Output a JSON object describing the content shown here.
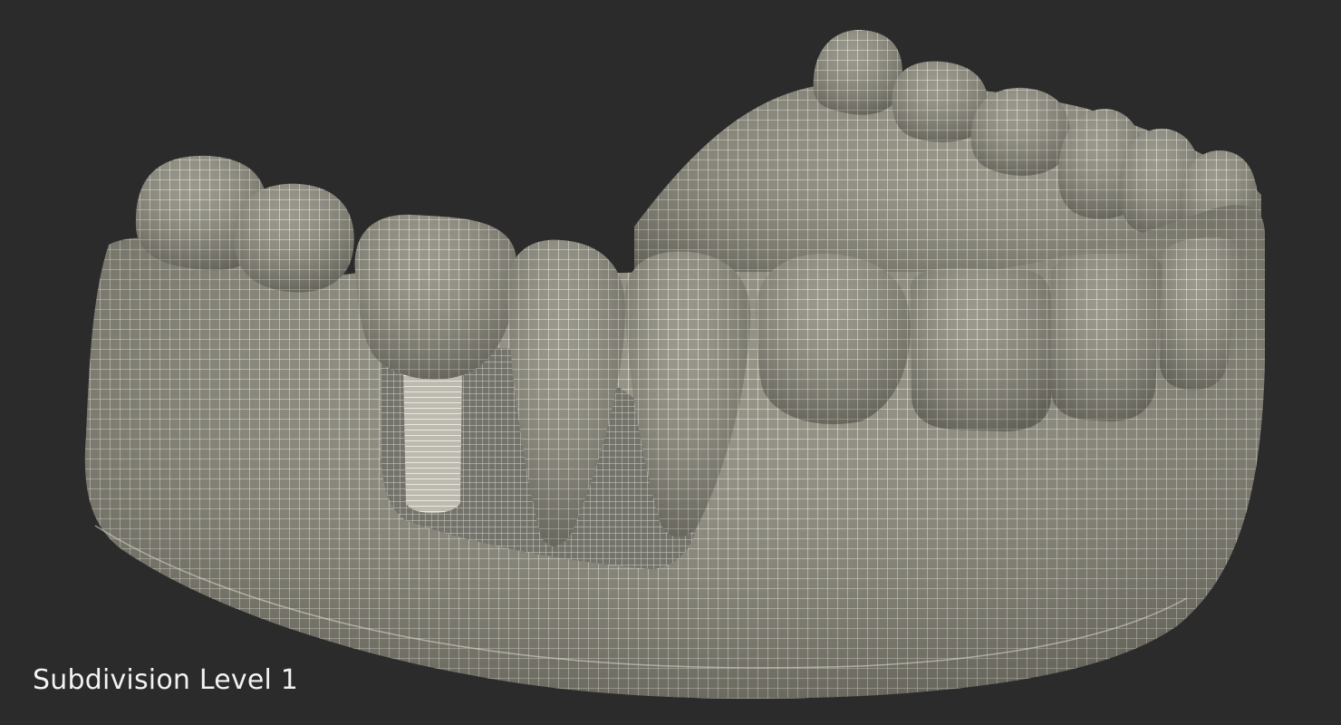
{
  "caption": "Subdivision Level 1",
  "colors": {
    "background": "#2b2b2b",
    "model_fill": "#8c8a7c",
    "model_shadow": "#5f5e55",
    "wire": "#f3f1e6",
    "caption": "#f2f2f2"
  },
  "model": {
    "subject": "dental-jaw-with-implant",
    "shading": "wireframe-on-shaded"
  }
}
